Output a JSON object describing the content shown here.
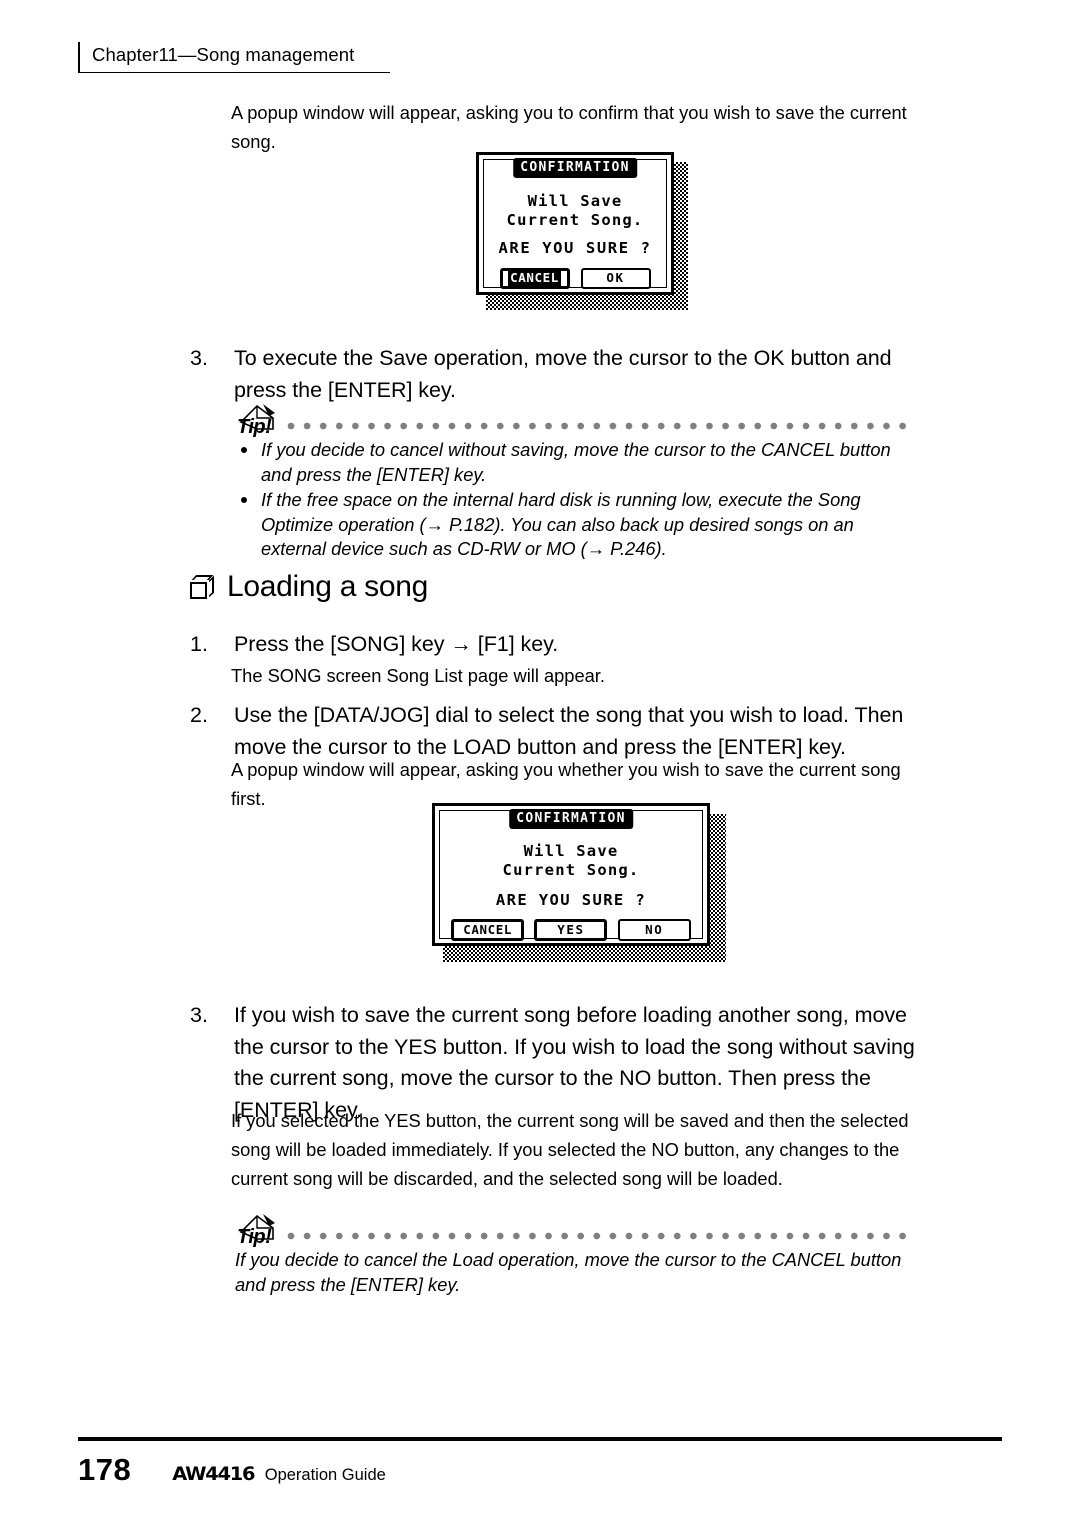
{
  "header": {
    "chapter": "Chapter11—Song management"
  },
  "intro_paragraph": "A popup window will appear, asking you to confirm that you wish to save the current song.",
  "dialog_save": {
    "title": "CONFIRMATION",
    "line1": "Will Save",
    "line2": "Current Song.",
    "question": "ARE YOU SURE ?",
    "buttons": [
      {
        "label": "CANCEL",
        "state": "highlighted"
      },
      {
        "label": "OK",
        "state": "normal"
      }
    ]
  },
  "step3_save": {
    "number": "3.",
    "text": "To execute the Save operation, move the cursor to the OK button and press the [ENTER] key."
  },
  "tip1": {
    "label": "Tip!",
    "items": [
      "If you decide to cancel without saving, move the cursor to the CANCEL button and press the [ENTER] key.",
      "If the free space on the internal hard disk is running low, execute the Song Optimize operation (→ P.182). You can also back up desired songs on an external device such as CD-RW or MO (→ P.246)."
    ]
  },
  "section": {
    "title": "Loading a song"
  },
  "step1_load": {
    "number": "1.",
    "text": "Press the [SONG] key → [F1] key.",
    "detail": "The SONG screen Song List page will appear."
  },
  "step2_load": {
    "number": "2.",
    "text": "Use the [DATA/JOG] dial to select the song that you wish to load. Then move the cursor to the LOAD button and press the [ENTER] key.",
    "detail": "A popup window will appear, asking you whether you wish to save the current song first."
  },
  "dialog_load": {
    "title": "CONFIRMATION",
    "line1": "Will Save",
    "line2": "Current Song.",
    "question": "ARE YOU SURE ?",
    "buttons": [
      {
        "label": "CANCEL",
        "state": "selected"
      },
      {
        "label": "YES",
        "state": "selected"
      },
      {
        "label": "NO",
        "state": "normal"
      }
    ]
  },
  "step3_load": {
    "number": "3.",
    "text": "If you wish to save the current song before loading another song, move the cursor to the YES button. If you wish to load the song without saving the current song, move the cursor to the NO button. Then press the [ENTER] key.",
    "detail": "If you selected the YES button, the current song will be saved and then the selected song will be loaded immediately. If you selected the NO button, any changes to the current song will be discarded, and the selected song will be loaded."
  },
  "tip2": {
    "label": "Tip!",
    "text": "If you decide to cancel the Load operation, move the cursor to the CANCEL button and press the [ENTER] key."
  },
  "footer": {
    "page": "178",
    "logo": "AW4416",
    "guide": "Operation Guide"
  }
}
